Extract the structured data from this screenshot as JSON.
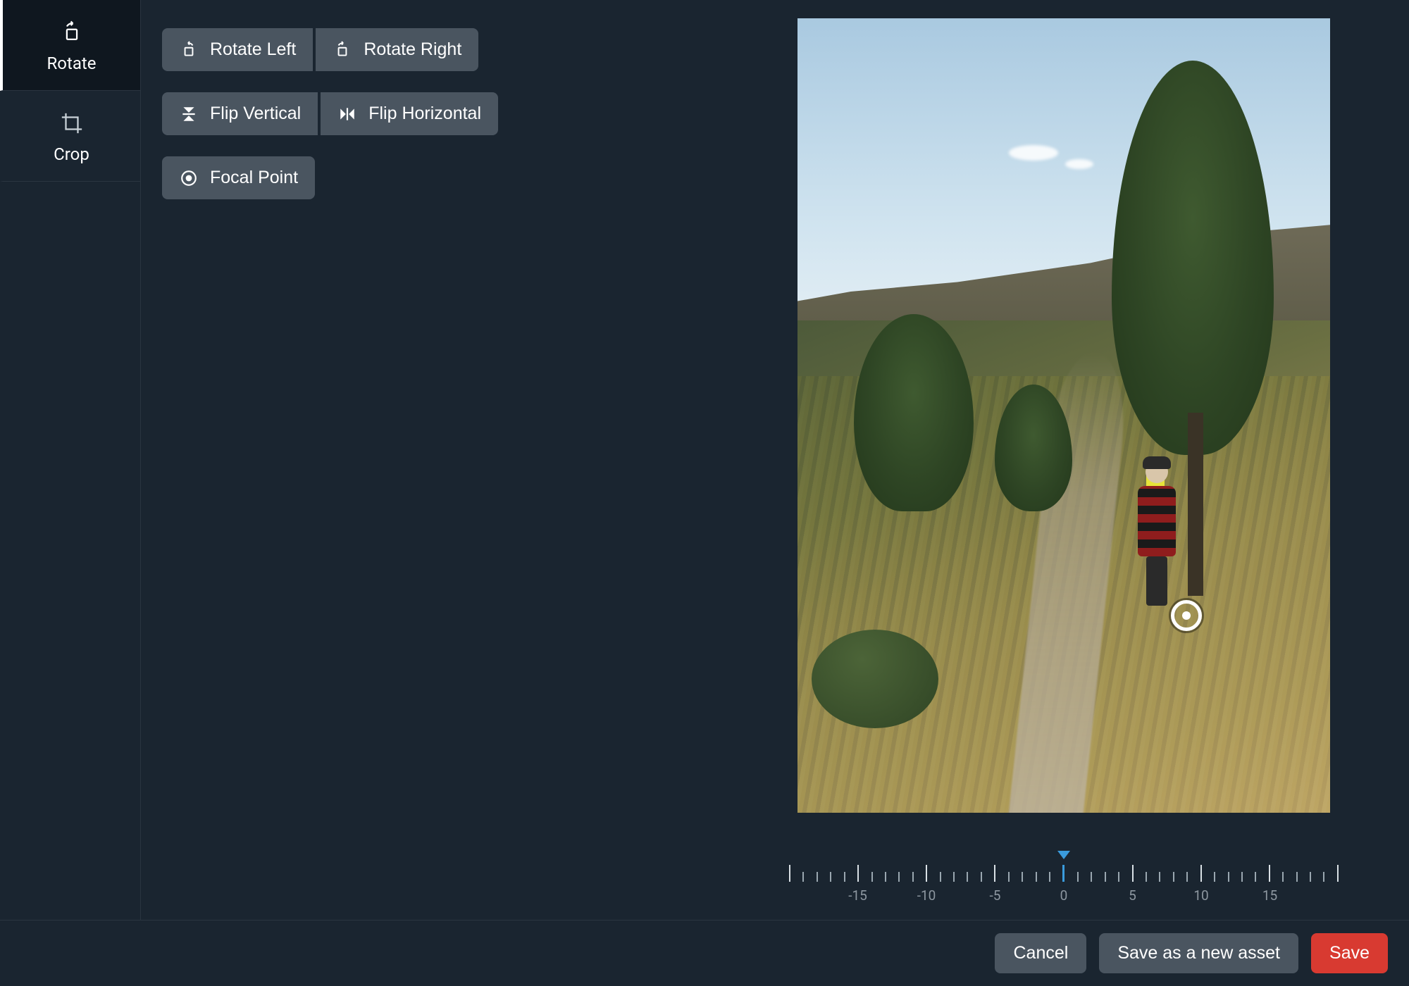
{
  "sidebar": {
    "tabs": [
      {
        "id": "rotate",
        "label": "Rotate",
        "active": true
      },
      {
        "id": "crop",
        "label": "Crop",
        "active": false
      }
    ]
  },
  "tools": {
    "rotate_left": "Rotate Left",
    "rotate_right": "Rotate Right",
    "flip_vertical": "Flip Vertical",
    "flip_horizontal": "Flip Horizontal",
    "focal_point": "Focal Point"
  },
  "ruler": {
    "min": -20,
    "max": 20,
    "step_major": 5,
    "step_minor": 1,
    "value": 0,
    "labels": [
      "-15",
      "-10",
      "-5",
      "0",
      "5",
      "10",
      "15"
    ]
  },
  "footer": {
    "cancel": "Cancel",
    "save_new": "Save as a new asset",
    "save": "Save"
  },
  "colors": {
    "bg": "#1a2530",
    "panel": "#0f171f",
    "button": "#4a5560",
    "accent": "#3a9bdc",
    "danger": "#d83a31"
  }
}
